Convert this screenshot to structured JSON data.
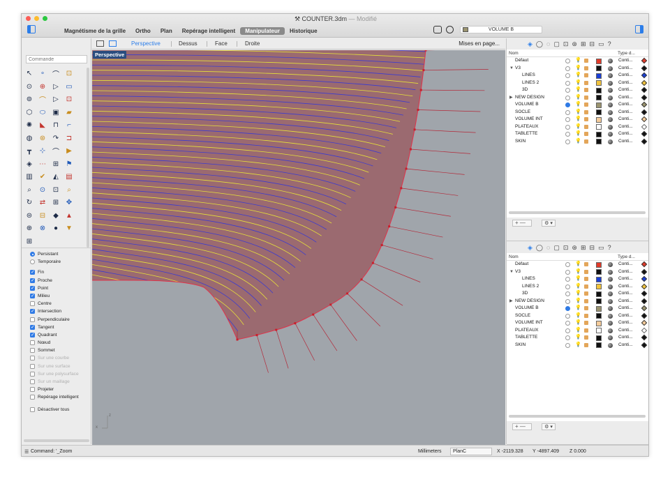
{
  "window": {
    "title": "COUNTER.3dm",
    "modified": "— Modifié"
  },
  "menu": [
    {
      "label": "Magnétisme de la grille",
      "active": false
    },
    {
      "label": "Ortho",
      "active": false
    },
    {
      "label": "Plan",
      "active": false
    },
    {
      "label": "Repérage intelligent",
      "active": false
    },
    {
      "label": "Manipulateur",
      "active": true
    },
    {
      "label": "Historique",
      "active": false
    }
  ],
  "current_layer": {
    "name": "VOLUME B",
    "color": "#9b9470"
  },
  "command_input": {
    "placeholder": "Commande"
  },
  "tools": [
    "↖",
    "∘",
    "⌒",
    "⊡",
    "⊙",
    "⊕",
    "▷",
    "▭",
    "⊚",
    "⌒",
    "▷",
    "⊡",
    "⬡",
    "⬭",
    "▣",
    "▰",
    "✺",
    "◣",
    "⊓",
    "⌐",
    "◍",
    "⊛",
    "↷",
    "⊐",
    "┳",
    "⊹",
    "⌒",
    "▶",
    "◈",
    "⋯",
    "⊞",
    "⚑",
    "▥",
    "✔",
    "◭",
    "▤",
    "⌕",
    "⊙",
    "⊡",
    "⌕",
    "↻",
    "⇄",
    "⊞",
    "✥",
    "⊜",
    "⊟",
    "◆",
    "▲",
    "⊕",
    "⊗",
    "●",
    "▼",
    "⊞"
  ],
  "osnaps": {
    "mode": [
      {
        "label": "Persistant",
        "on": true
      },
      {
        "label": "Temporaire",
        "on": false
      }
    ],
    "items": [
      {
        "label": "Fin",
        "on": true,
        "disabled": false
      },
      {
        "label": "Proche",
        "on": true,
        "disabled": false
      },
      {
        "label": "Point",
        "on": true,
        "disabled": false
      },
      {
        "label": "Milieu",
        "on": true,
        "disabled": false
      },
      {
        "label": "Centre",
        "on": false,
        "disabled": false
      },
      {
        "label": "Intersection",
        "on": true,
        "disabled": false
      },
      {
        "label": "Perpendiculaire",
        "on": false,
        "disabled": false
      },
      {
        "label": "Tangent",
        "on": true,
        "disabled": false
      },
      {
        "label": "Quadrant",
        "on": true,
        "disabled": false
      },
      {
        "label": "Nœud",
        "on": false,
        "disabled": false
      },
      {
        "label": "Sommet",
        "on": false,
        "disabled": false
      },
      {
        "label": "Sur une courbe",
        "on": false,
        "disabled": true
      },
      {
        "label": "Sur une surface",
        "on": false,
        "disabled": true
      },
      {
        "label": "Sur une polysurface",
        "on": false,
        "disabled": true
      },
      {
        "label": "Sur un maillage",
        "on": false,
        "disabled": true
      },
      {
        "label": "Projeter",
        "on": false,
        "disabled": false
      },
      {
        "label": "Repérage intelligent",
        "on": false,
        "disabled": false
      }
    ],
    "disable_all": "Désactiver tous"
  },
  "view_tabs": {
    "tabs": [
      "Perspective",
      "Dessus",
      "Face",
      "Droite"
    ],
    "active": "Perspective",
    "more": "Mises en page..."
  },
  "viewport": {
    "label": "Perspective",
    "axis_x": "x",
    "axis_z": "z"
  },
  "layers": {
    "header_name": "Nom",
    "header_type": "Type d...",
    "rows": [
      {
        "name": "Défaut",
        "indent": 0,
        "disclosure": "",
        "current": false,
        "lit": false,
        "color": "#e23b2a",
        "linetype": "Conti...",
        "print_color": "#e23b2a"
      },
      {
        "name": "V3",
        "indent": 0,
        "disclosure": "▼",
        "current": false,
        "lit": true,
        "color": "#111111",
        "linetype": "Conti...",
        "print_color": "#111111"
      },
      {
        "name": "LINES",
        "indent": 1,
        "disclosure": "",
        "current": false,
        "lit": false,
        "color": "#1a3fd6",
        "linetype": "Conti...",
        "print_color": "#1a3fd6"
      },
      {
        "name": "LINES 2",
        "indent": 1,
        "disclosure": "",
        "current": false,
        "lit": false,
        "color": "#f2c43d",
        "linetype": "Conti...",
        "print_color": "#f2c43d"
      },
      {
        "name": "3D",
        "indent": 1,
        "disclosure": "",
        "current": false,
        "lit": false,
        "color": "#111111",
        "linetype": "Conti...",
        "print_color": "#111111"
      },
      {
        "name": "NEW DESIGN",
        "indent": 0,
        "disclosure": "▶",
        "current": false,
        "lit": false,
        "color": "#111111",
        "linetype": "Conti...",
        "print_color": "#111111"
      },
      {
        "name": "VOLUME B",
        "indent": 0,
        "disclosure": "",
        "current": true,
        "lit": false,
        "color": "#9b9470",
        "linetype": "Conti...",
        "print_color": "#9b9470"
      },
      {
        "name": "SOCLE",
        "indent": 0,
        "disclosure": "",
        "current": false,
        "lit": false,
        "color": "#111111",
        "linetype": "Conti...",
        "print_color": "#111111"
      },
      {
        "name": "VOLUME INT",
        "indent": 0,
        "disclosure": "",
        "current": false,
        "lit": false,
        "color": "#f5cc9b",
        "linetype": "Conti...",
        "print_color": "#f5cc9b"
      },
      {
        "name": "PLATEAUX",
        "indent": 0,
        "disclosure": "",
        "current": false,
        "lit": false,
        "color": "#ffffff",
        "linetype": "Conti...",
        "print_color": "#ffffff"
      },
      {
        "name": "TABLETTE",
        "indent": 0,
        "disclosure": "",
        "current": false,
        "lit": false,
        "color": "#111111",
        "linetype": "Conti...",
        "print_color": "#111111"
      },
      {
        "name": "SKIN",
        "indent": 0,
        "disclosure": "",
        "current": false,
        "lit": false,
        "color": "#111111",
        "linetype": "Conti...",
        "print_color": "#111111"
      }
    ],
    "add_remove": "+ —",
    "gear": "⚙ ▾"
  },
  "status": {
    "command": "Command: '_Zoom",
    "units": "Millimeters",
    "plane": "PlanC",
    "x": "X -2119.328",
    "y": "Y -4897.409",
    "z": "Z 0.000"
  },
  "colors": {
    "surface": "#9b6a70",
    "curve_blue": "#3b3bd0",
    "curve_yellow": "#e6e03a",
    "edge": "#e0324a",
    "viewport_bg": "#a0a5ab"
  }
}
